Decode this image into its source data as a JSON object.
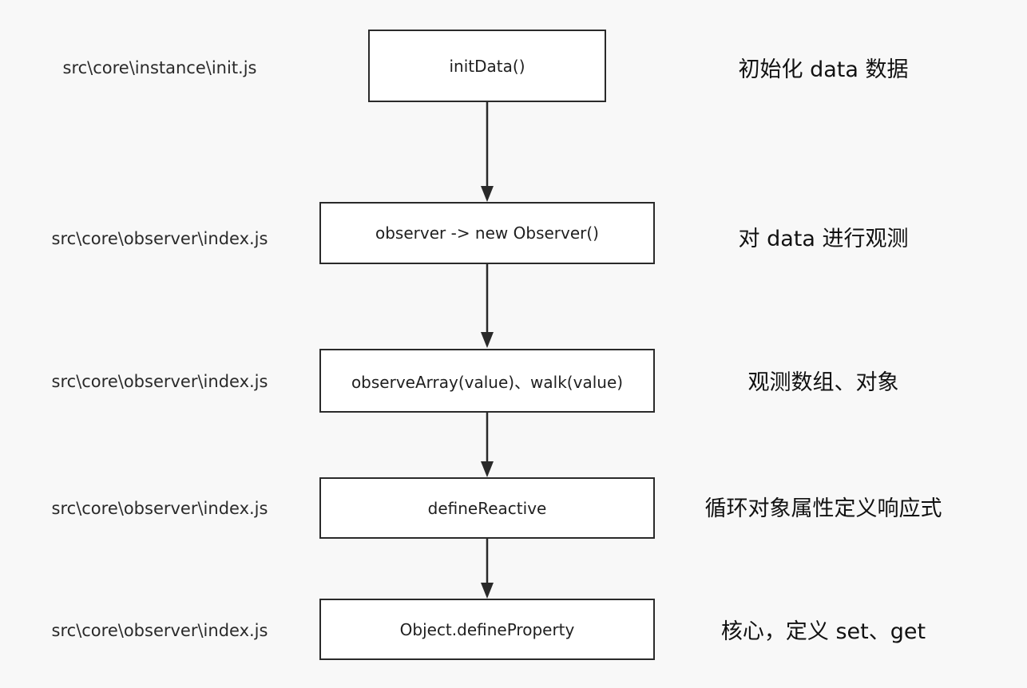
{
  "colors": {
    "background": "#f8f8f8",
    "stroke": "#2a2a2a",
    "box_fill": "#ffffff"
  },
  "steps": [
    {
      "path": "src\\core\\instance\\init.js",
      "label": "initData()",
      "desc": "初始化 data 数据"
    },
    {
      "path": "src\\core\\observer\\index.js",
      "label": "observer -> new Observer()",
      "desc": "对 data 进行观测"
    },
    {
      "path": "src\\core\\observer\\index.js",
      "label": "observeArray(value)、walk(value)",
      "desc": "观测数组、对象"
    },
    {
      "path": "src\\core\\observer\\index.js",
      "label": "defineReactive",
      "desc": "循环对象属性定义响应式"
    },
    {
      "path": "src\\core\\observer\\index.js",
      "label": "Object.defineProperty",
      "desc": "核心，定义 set、get"
    }
  ]
}
